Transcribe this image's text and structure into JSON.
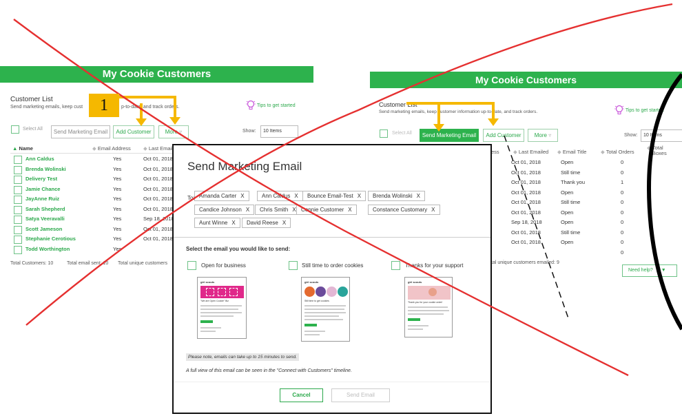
{
  "left_panel": {
    "banner_title": "My Cookie Customers",
    "section_title": "Customer List",
    "subtitle": "Send marketing emails, keep customer information up-to-date, and track orders.",
    "subtitle_visible_start": "Send marketing emails, keep cust",
    "subtitle_visible_end": "p-to-date, and track orders.",
    "tips_label": "Tips to get started",
    "select_all_label": "Select All",
    "send_marketing_label": "Send Marketing Email",
    "add_customer_label": "Add Customer",
    "more_label": "More",
    "show_label": "Show:",
    "show_value": "10 Items",
    "col_name": "Name",
    "col_email_address": "Email Address",
    "col_last_emailed": "Last Email",
    "rows": [
      {
        "name": "Ann Caldus",
        "email": "Yes",
        "last": "Oct 01, 2018"
      },
      {
        "name": "Brenda Wolinski",
        "email": "Yes",
        "last": "Oct 01, 2018"
      },
      {
        "name": "Delivery Test",
        "email": "Yes",
        "last": "Oct 01, 2018"
      },
      {
        "name": "Jamie Chance",
        "email": "Yes",
        "last": "Oct 01, 2018"
      },
      {
        "name": "JayAnne Ruiz",
        "email": "Yes",
        "last": "Oct 01, 2018"
      },
      {
        "name": "Sarah Shepherd",
        "email": "Yes",
        "last": "Oct 01, 2018"
      },
      {
        "name": "Satya Veeravalli",
        "email": "Yes",
        "last": "Sep 18, 2018"
      },
      {
        "name": "Scott Jameson",
        "email": "Yes",
        "last": "Oct 01, 2018"
      },
      {
        "name": "Stephanie Cerotious",
        "email": "Yes",
        "last": "Oct 01, 2018"
      },
      {
        "name": "Todd Worthington",
        "email": "Yes",
        "last": ""
      }
    ],
    "footer_total_customers": "Total Customers: 10",
    "footer_total_sent": "Total email sent: 10",
    "footer_unique": "Total unique customers"
  },
  "right_panel": {
    "banner_title": "My Cookie Customers",
    "section_title": "Customer List",
    "subtitle": "Send marketing emails, keep customer information up-to-date, and track orders.",
    "tips_label": "Tips to get started",
    "select_all_label": "Select All",
    "send_marketing_label": "Send Marketing Email",
    "add_customer_label": "Add Customer",
    "more_label": "More",
    "show_label": "Show:",
    "show_value": "10 Items",
    "col_address": "ess",
    "col_last_emailed": "Last Emailed",
    "col_email_title": "Email Title",
    "col_total_orders": "Total Orders",
    "col_total_boxes": "Total Boxes",
    "rows": [
      {
        "last": "Oct 01, 2018",
        "title": "Open",
        "orders": "0"
      },
      {
        "last": "Oct 01, 2018",
        "title": "Still time",
        "orders": "0"
      },
      {
        "last": "Oct 01, 2018",
        "title": "Thank you",
        "orders": "1"
      },
      {
        "last": "Oct 01, 2018",
        "title": "Open",
        "orders": "0"
      },
      {
        "last": "Oct 01, 2018",
        "title": "Still time",
        "orders": "0"
      },
      {
        "last": "Oct 01, 2018",
        "title": "Open",
        "orders": "0"
      },
      {
        "last": "Sep 18, 2018",
        "title": "Open",
        "orders": "0"
      },
      {
        "last": "Oct 01, 2018",
        "title": "Still time",
        "orders": "0"
      },
      {
        "last": "Oct 01, 2018",
        "title": "Open",
        "orders": "0"
      },
      {
        "last": "",
        "title": "",
        "orders": "0"
      }
    ],
    "footer_unique": "tal unique customers emailed: 9",
    "need_help_label": "Need help?"
  },
  "annotation": {
    "step_number": "1"
  },
  "modal": {
    "title": "Send Marketing Email",
    "to_label": "To:",
    "recipients": [
      "Amanda Carter",
      "Ann Caldus",
      "Bounce Email-Test",
      "Brenda Wolinski",
      "Candice Johnson",
      "Chris Smith",
      "Connie Customer",
      "Constance Customary",
      "Aunt Winne",
      "David Reese"
    ],
    "remove_glyph": "X",
    "select_prompt": "Select the email you would like to send:",
    "options": [
      {
        "label": "Open for business",
        "thumb_heading": "\"We are Open Cookie\" Biz"
      },
      {
        "label": "Still time to order cookies",
        "thumb_heading": "Still time to get cookies"
      },
      {
        "label": "Thanks for your support",
        "thumb_heading": "Thank you for your cookie order!"
      }
    ],
    "thumb_brand": "girl scouts",
    "note": "Please note, emails can take up to 15 minutes to send.",
    "full_view_note": "A full view of this email can be seen in the \"Connect with Customers\" timeline.",
    "cancel_label": "Cancel",
    "send_label": "Send Email"
  },
  "colors": {
    "brand_green": "#2db24d",
    "annotation_arrow": "#f5b800",
    "cross_line": "#e53030"
  }
}
